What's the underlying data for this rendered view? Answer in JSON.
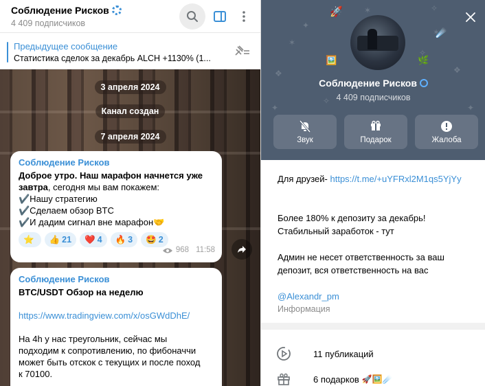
{
  "channel": {
    "name": "Соблюдение Рисков",
    "subscribers": "4 409 подписчиков"
  },
  "pinned": {
    "label": "Предыдущее сообщение",
    "text": "Статистика сделок за декабрь  ALCH +1130% (1..."
  },
  "dates": [
    "3 апреля 2024",
    "Канал создан",
    "7 апреля 2024"
  ],
  "messages": [
    {
      "author": "Соблюдение Рисков",
      "lines": [
        "Доброе утро. Наш марафон начнется уже",
        "завтра, сегодня мы вам покажем:",
        "✔️Нашу стратегию",
        "✔️Сделаем обзор BTC",
        "✔️И дадим сигнал вне марафон🤝"
      ],
      "reactions": [
        {
          "emoji": "⭐",
          "count": ""
        },
        {
          "emoji": "👍",
          "count": "21"
        },
        {
          "emoji": "❤️",
          "count": "4"
        },
        {
          "emoji": "🔥",
          "count": "3"
        },
        {
          "emoji": "🤩",
          "count": "2"
        }
      ],
      "views": "968",
      "time": "11:58"
    },
    {
      "author": "Соблюдение Рисков",
      "title": "BTC/USDT Обзор на неделю",
      "link": "https://www.tradingview.com/x/osGWdDhE/",
      "body": [
        "На 4h у нас треугольник, сейчас мы",
        "подходим к сопротивлению, по фибоначчи",
        "может быть отскок с текущих и после поход",
        "к 70100."
      ]
    }
  ],
  "profile": {
    "actions": [
      {
        "label": "Звук",
        "icon": "mute-icon"
      },
      {
        "label": "Подарок",
        "icon": "gift-icon"
      },
      {
        "label": "Жалоба",
        "icon": "report-icon"
      }
    ],
    "friends_label": "Для друзей-",
    "friends_link": "https://t.me/+uYFRxl2M1qs5YjYy",
    "desc1": "Более 180% к депозиту за декабрь!",
    "desc2": "Стабильный заработок - тут",
    "desc3": "Админ не несет ответственность за ваш",
    "desc4": "депозит, вся ответственность на вас",
    "handle": "@Alexandr_pm",
    "info_label": "Информация",
    "publications": "11 публикаций",
    "gifts": "6 подарков"
  },
  "colors": {
    "accent": "#3a8fd6",
    "cover": "#4e5d70"
  }
}
